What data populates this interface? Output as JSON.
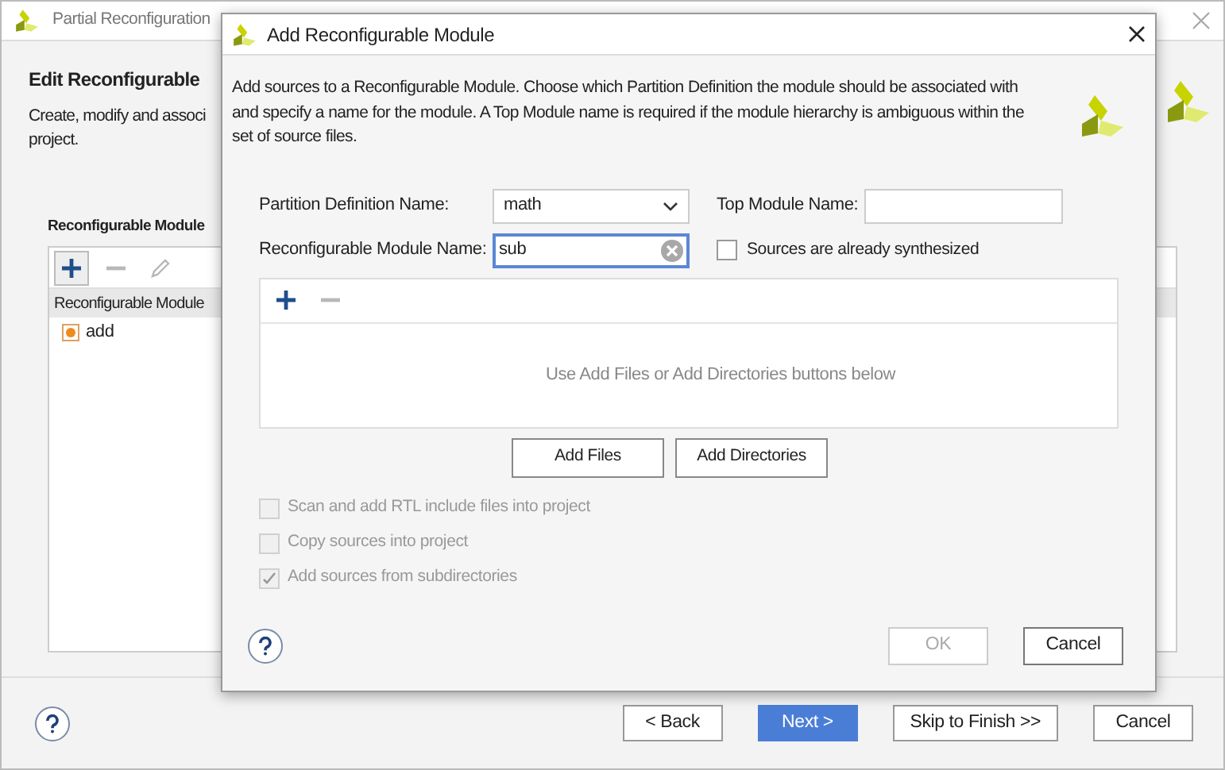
{
  "wizard": {
    "title": "Partial Reconfiguration",
    "heading": "Edit Reconfigurable",
    "description_lines": [
      "Create, modify and associ",
      "project."
    ],
    "panel_title": "Reconfigurable Module",
    "toolbar": [
      {
        "kind": "add",
        "disabled": false
      },
      {
        "kind": "remove",
        "disabled": true
      },
      {
        "kind": "edit",
        "disabled": true
      }
    ],
    "table": {
      "columns": [
        "Reconfigurable Module"
      ],
      "rows": [
        {
          "name": "add"
        }
      ]
    },
    "buttons": [
      {
        "label": "< Back",
        "kind": "default"
      },
      {
        "label": "Next >",
        "kind": "primary"
      },
      {
        "label": "Skip to Finish >>",
        "kind": "default"
      },
      {
        "label": "Cancel",
        "kind": "default"
      }
    ]
  },
  "dialog": {
    "title": "Add Reconfigurable Module",
    "description": "Add sources to a Reconfigurable Module. Choose which Partition Definition the module should be associated with and specify a name for the module. A Top Module name is required if the module hierarchy is ambiguous within the set of source files.",
    "partition_definition": {
      "label": "Partition Definition Name:",
      "value": "math"
    },
    "module_name": {
      "label": "Reconfigurable Module Name:",
      "value": "sub",
      "focused": true
    },
    "top_module": {
      "label": "Top Module Name:"
    },
    "synthesized": {
      "label": "Sources are already synthesized",
      "checked": false
    },
    "sources_toolbar": [
      {
        "kind": "add",
        "disabled": false
      },
      {
        "kind": "remove",
        "disabled": true
      }
    ],
    "empty_message": "Use Add Files or Add Directories buttons below",
    "add_buttons": [
      "Add Files",
      "Add Directories"
    ],
    "options": [
      {
        "label": "Scan and add RTL include files into project",
        "checked": false,
        "disabled": true
      },
      {
        "label": "Copy sources into project",
        "checked": false,
        "disabled": true
      },
      {
        "label": "Add sources from subdirectories",
        "checked": true,
        "disabled": true
      }
    ],
    "buttons": [
      {
        "label": "OK",
        "disabled": true
      },
      {
        "label": "Cancel",
        "disabled": false
      }
    ]
  }
}
